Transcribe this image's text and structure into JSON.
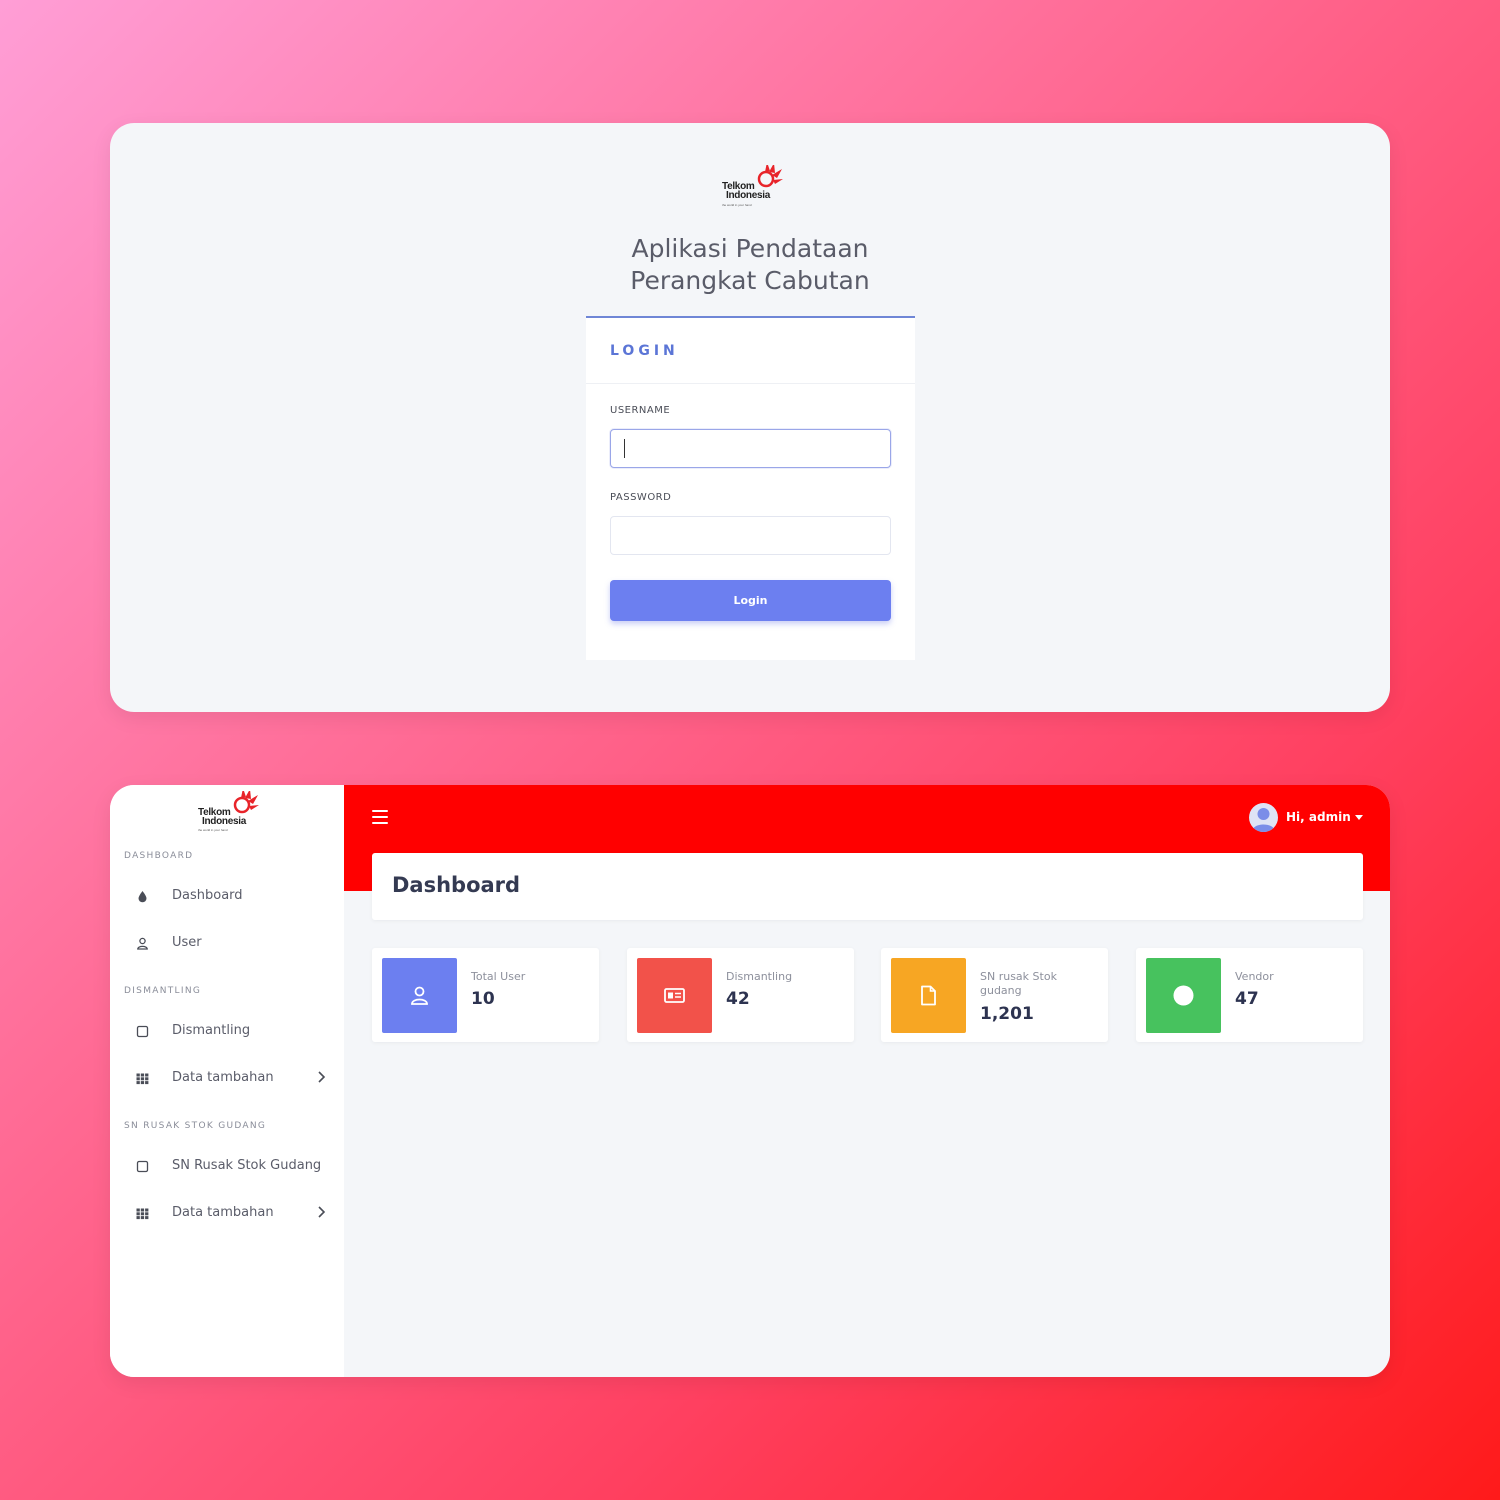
{
  "brand": {
    "logo_line1": "Telkom",
    "logo_line2": "Indonesia",
    "logo_tagline": "the world in your hand",
    "logo_color": "#e8242a"
  },
  "login": {
    "title_line1": "Aplikasi Pendataan",
    "title_line2": "Perangkat Cabutan",
    "card_title": "LOGIN",
    "username_label": "USERNAME",
    "username_value": "",
    "password_label": "PASSWORD",
    "password_value": "",
    "submit_label": "Login",
    "accent_color": "#6c7ff0"
  },
  "sidebar": {
    "sections": [
      {
        "heading": "DASHBOARD"
      },
      {
        "heading": "DISMANTLING"
      },
      {
        "heading": "SN RUSAK STOK GUDANG"
      }
    ],
    "items": [
      {
        "label": "Dashboard",
        "icon": "drop-icon"
      },
      {
        "label": "User",
        "icon": "user-icon"
      },
      {
        "label": "Dismantling",
        "icon": "square-icon"
      },
      {
        "label": "Data tambahan",
        "icon": "grid-icon",
        "has_submenu": true
      },
      {
        "label": "SN Rusak Stok Gudang",
        "icon": "square-icon"
      },
      {
        "label": "Data tambahan",
        "icon": "grid-icon",
        "has_submenu": true
      }
    ]
  },
  "topbar": {
    "greeting": "Hi, admin",
    "color": "#ff0000"
  },
  "dashboard": {
    "page_title": "Dashboard",
    "stats": [
      {
        "label": "Total User",
        "value": "10",
        "color": "#6c7ff0",
        "icon": "user-icon"
      },
      {
        "label": "Dismantling",
        "value": "42",
        "color": "#f2524a",
        "icon": "id-card-icon"
      },
      {
        "label": "SN rusak Stok gudang",
        "value": "1,201",
        "color": "#f7a623",
        "icon": "file-icon"
      },
      {
        "label": "Vendor",
        "value": "47",
        "color": "#47c25e",
        "icon": "circle-icon"
      }
    ]
  }
}
